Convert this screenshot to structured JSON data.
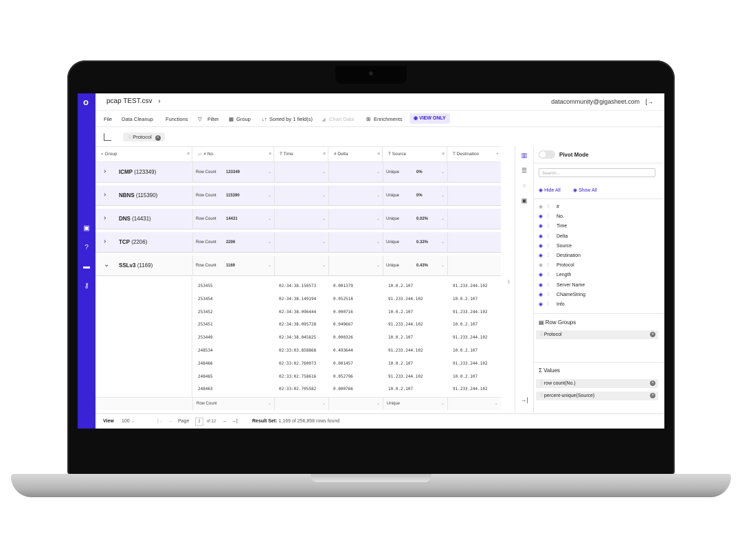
{
  "header": {
    "file_name": "pcap TEST.csv",
    "breadcrumb_chevron": "›",
    "email": "datacommunity@gigasheet.com",
    "logout_icon": "[→"
  },
  "toolbar": {
    "file": "File",
    "data_cleanup": "Data Cleanup",
    "functions": "Functions",
    "filter": "Filter",
    "group": "Group",
    "sorted": "Sorted by 1 field(s)",
    "chart_data": "Chart Data",
    "enrichments": "Enrichments",
    "view_only": "VIEW ONLY"
  },
  "row_group_chip": "Protocol",
  "columns": {
    "group": "Group",
    "no": "No.",
    "time": "Time",
    "delta": "Delta",
    "source": "Source",
    "destination": "Destination",
    "menu": "≡",
    "add": "+"
  },
  "groups": [
    {
      "name": "ICMP",
      "count": "(123349)",
      "agg_label": "Row Count",
      "agg_value": "123349",
      "src_label": "Unique",
      "src_value": "0%",
      "open": false
    },
    {
      "name": "NBNS",
      "count": "(115390)",
      "agg_label": "Row Count",
      "agg_value": "115390",
      "src_label": "Unique",
      "src_value": "0%",
      "open": false
    },
    {
      "name": "DNS",
      "count": "(14431)",
      "agg_label": "Row Count",
      "agg_value": "14431",
      "src_label": "Unique",
      "src_value": "0.02%",
      "open": false
    },
    {
      "name": "TCP",
      "count": "(2206)",
      "agg_label": "Row Count",
      "agg_value": "2206",
      "src_label": "Unique",
      "src_value": "0.32%",
      "open": false
    },
    {
      "name": "SSLv3",
      "count": "(1169)",
      "agg_label": "Row Count",
      "agg_value": "1169",
      "src_label": "Unique",
      "src_value": "0.43%",
      "open": true
    }
  ],
  "detail_rows": [
    {
      "no": "253455",
      "time": "02:34:38.150573",
      "delta": "0.001379",
      "source": "10.0.2.107",
      "destination": "91.233.244.102"
    },
    {
      "no": "253454",
      "time": "02:34:38.149194",
      "delta": "0.052518",
      "source": "91.233.244.102",
      "destination": "10.0.2.107"
    },
    {
      "no": "253452",
      "time": "02:34:38.096444",
      "delta": "0.000716",
      "source": "10.0.2.107",
      "destination": "91.233.244.102"
    },
    {
      "no": "253451",
      "time": "02:34:38.095728",
      "delta": "0.049667",
      "source": "91.233.244.102",
      "destination": "10.0.2.107"
    },
    {
      "no": "253449",
      "time": "02:34:38.045825",
      "delta": "0.000326",
      "source": "10.0.2.107",
      "destination": "91.233.244.102"
    },
    {
      "no": "248534",
      "time": "02:33:03.858868",
      "delta": "0.493644",
      "source": "91.233.244.102",
      "destination": "10.0.2.107"
    },
    {
      "no": "248466",
      "time": "02:33:02.760073",
      "delta": "0.001457",
      "source": "10.0.2.107",
      "destination": "91.233.244.102"
    },
    {
      "no": "248465",
      "time": "02:33:02.758616",
      "delta": "0.052796",
      "source": "91.233.244.102",
      "destination": "10.0.2.107"
    },
    {
      "no": "248463",
      "time": "02:33:02.705582",
      "delta": "0.000766",
      "source": "10.0.2.107",
      "destination": "91.233.244.102"
    }
  ],
  "footer_aggs": {
    "no": "Row Count",
    "source": "Unique"
  },
  "panel": {
    "pivot_mode": "Pivot Mode",
    "search_placeholder": "Search...",
    "hide_all": "Hide All",
    "show_all": "Show All",
    "columns": [
      "#",
      "No.",
      "Time",
      "Delta",
      "Source",
      "Destination",
      "Protocol",
      "Length",
      "Server Name",
      "CNameString",
      "Info"
    ],
    "row_groups_title": "Row Groups",
    "row_group_item": "Protocol",
    "values_title": "Values",
    "values": [
      "row count(No.)",
      "percent-unique(Source)"
    ]
  },
  "bottom": {
    "view": "View",
    "page_size": "100",
    "page_label": "Page",
    "page": "1",
    "of": "of 12",
    "result_label": "Result Set:",
    "result_text": "1,169 of 256,858 rows found"
  },
  "colors": {
    "accent": "#3a22d6",
    "group_bg": "#f2f0fd"
  }
}
